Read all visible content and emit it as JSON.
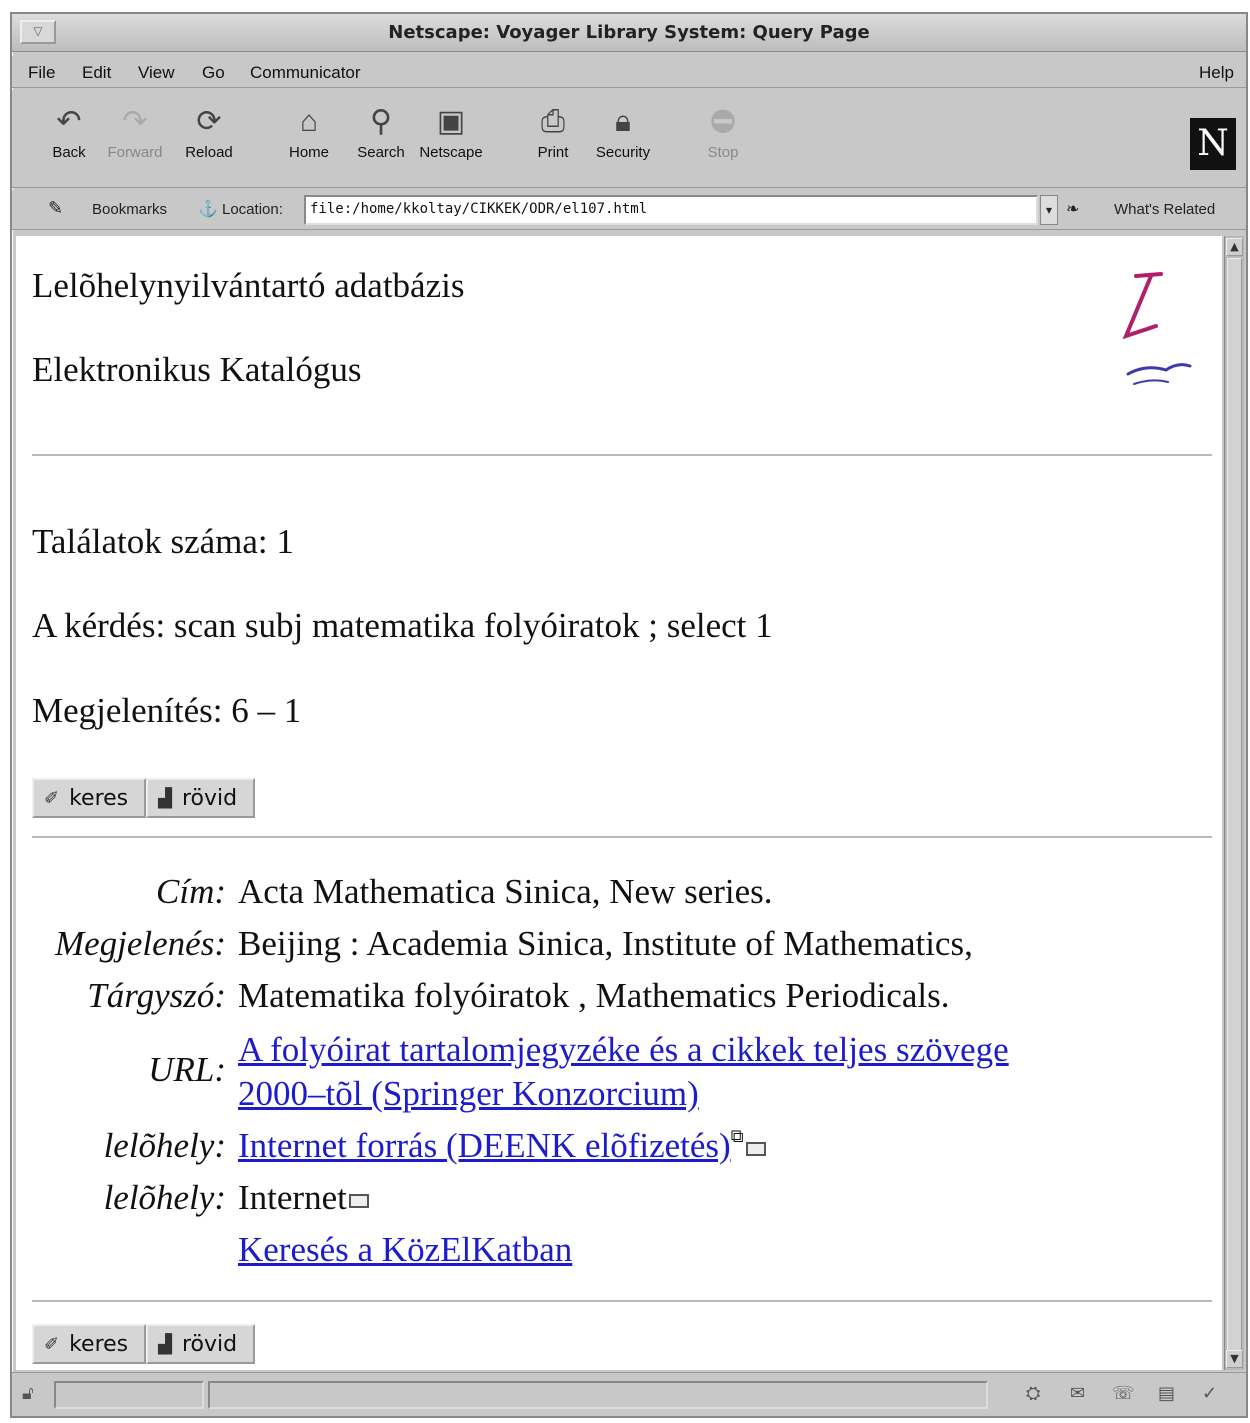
{
  "window": {
    "title": "Netscape: Voyager Library System: Query Page"
  },
  "menu": [
    "File",
    "Edit",
    "View",
    "Go",
    "Communicator",
    "Help"
  ],
  "toolbar": {
    "buttons": [
      "Back",
      "Forward",
      "Reload",
      "Home",
      "Search",
      "Netscape",
      "Print",
      "Security",
      "Stop"
    ],
    "logo_letter": "N"
  },
  "location_bar": {
    "bookmarks_label": "Bookmarks",
    "location_label": "Location:",
    "url": "file:/home/kkoltay/CIKKEK/ODR/el107.html",
    "whats_related_label": "What's Related"
  },
  "page": {
    "heading_1": "Lelõhelynyilvántartó adatbázis",
    "heading_2": "Elektronikus Katalógus",
    "hits_label": "Találatok száma: 1",
    "query_label": "A kérdés: scan subj matematika folyóiratok ; select 1",
    "display_label": "Megjelenítés: 6 – 1",
    "search_button": "keres",
    "short_button": "rövid"
  },
  "record": {
    "title_label": "Cím:",
    "title_value": "Acta Mathematica Sinica, New series.",
    "pub_label": "Megjelenés:",
    "pub_value": "Beijing : Academia Sinica, Institute of Mathematics,",
    "subject_label": "Tárgyszó:",
    "subject_value": "Matematika folyóiratok , Mathematics Periodicals.",
    "url_label": "URL:",
    "url_link_line1": "A folyóirat tartalomjegyzéke és a cikkek teljes szövege",
    "url_link_line2": "2000–tõl (Springer Konzorcium) ",
    "location1_label": "lelõhely:",
    "location1_value": "Internet forrás (DEENK elõfizetés)",
    "location2_label": "lelõhely:",
    "location2_value": "Internet",
    "search_link": "Keresés a KözElKatban"
  }
}
